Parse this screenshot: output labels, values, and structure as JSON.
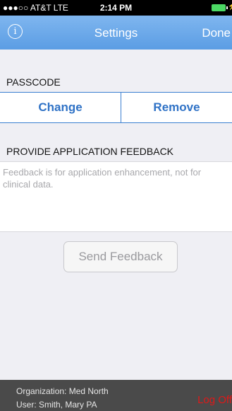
{
  "status_bar": {
    "carrier": "●●●○○ AT&T  LTE",
    "time": "2:14 PM"
  },
  "nav": {
    "title": "Settings",
    "done_label": "Done",
    "info_glyph": "i",
    "info_icon": "info-circle-icon"
  },
  "passcode": {
    "section_label": "PASSCODE",
    "change_label": "Change",
    "remove_label": "Remove"
  },
  "feedback": {
    "section_label": "PROVIDE APPLICATION FEEDBACK",
    "placeholder": "Feedback is for application enhancement, not for clinical data.",
    "send_label": "Send Feedback"
  },
  "footer": {
    "organization": "Organization: Med North",
    "user": "User: Smith, Mary PA",
    "logoff_label": "Log Off"
  },
  "colors": {
    "nav_bar": "#5b9de4",
    "accent": "#2f72c6",
    "logoff": "#e01818",
    "footer_bg": "#4a4a4a"
  }
}
